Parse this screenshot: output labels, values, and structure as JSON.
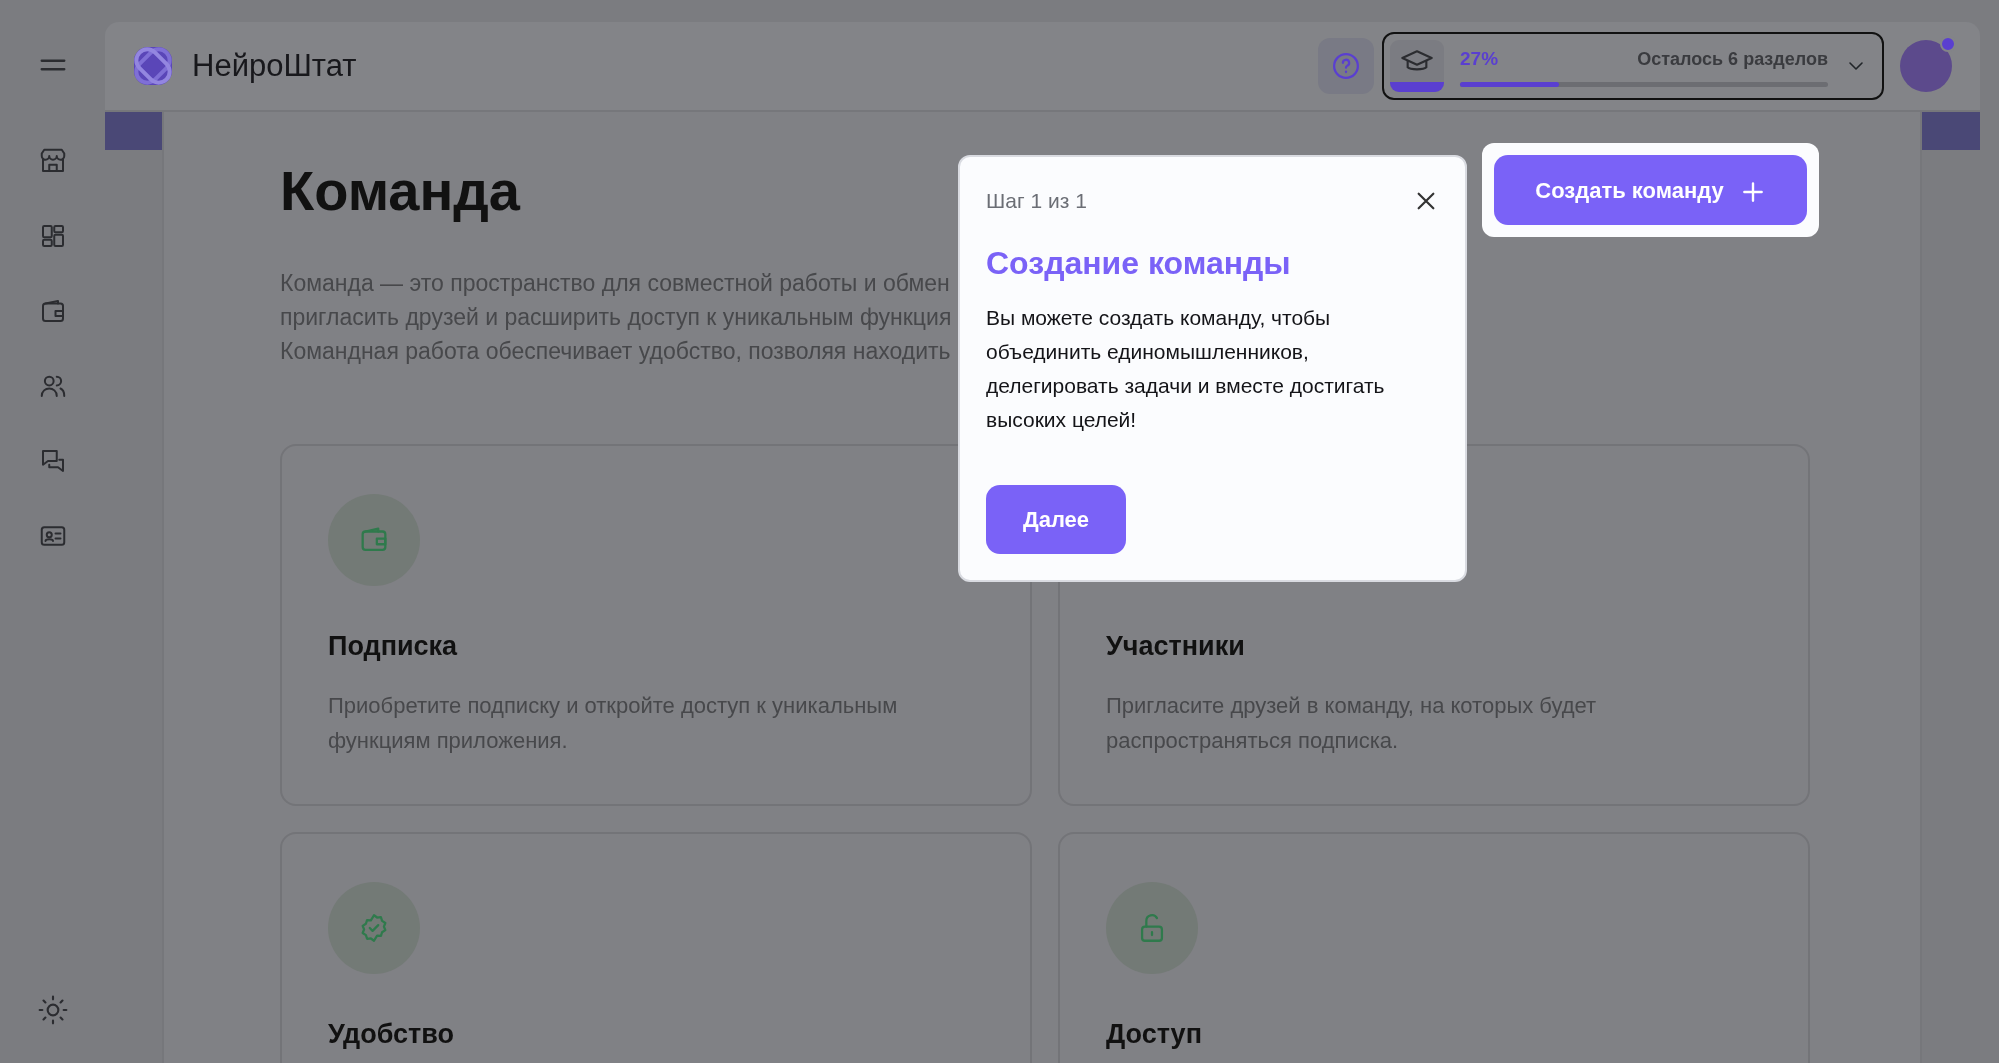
{
  "header": {
    "brand": "НейроШтат",
    "progress": {
      "percent": "27%",
      "level": 0.27,
      "remaining": "Осталось 6 разделов"
    }
  },
  "page": {
    "title": "Команда",
    "description_lines": [
      "Команда — это пространство для совместной работы и обмен",
      "пригласить друзей и расширить доступ к уникальным функция",
      "Командная работа обеспечивает удобство, позволяя находить"
    ],
    "create_button": "Создать команду"
  },
  "cards": [
    {
      "title": "Подписка",
      "text": "Приобретите подписку и откройте доступ к уникальным функциям приложения."
    },
    {
      "title": "Участники",
      "text": "Пригласите друзей в команду, на которых будет распространяться подписка."
    },
    {
      "title": "Удобство"
    },
    {
      "title": "Доступ"
    }
  ],
  "tour_popup": {
    "step": "Шаг 1 из 1",
    "title": "Создание команды",
    "body": "Вы можете создать команду, чтобы объединить единомышленников, делегировать задачи и вместе достигать высоких целей!",
    "next_button": "Далее"
  }
}
